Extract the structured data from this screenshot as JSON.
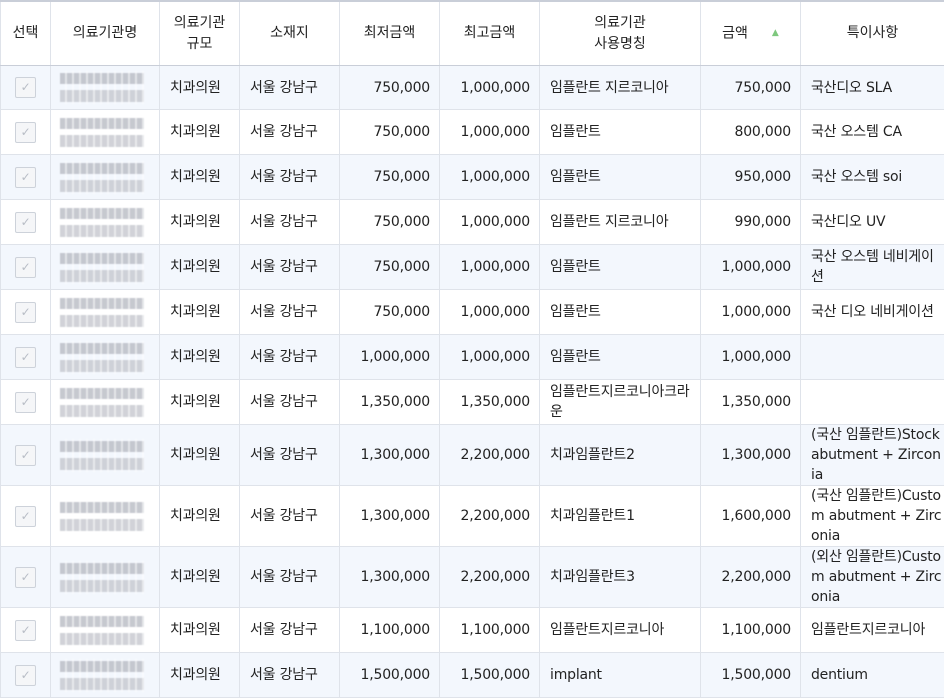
{
  "table": {
    "headers": {
      "select": "선택",
      "institution_name": "의료기관명",
      "institution_size": "의료기관\n규모",
      "location": "소재지",
      "min_amount": "최저금액",
      "max_amount": "최고금액",
      "usage_name": "의료기관\n사용명칭",
      "amount": "금액",
      "remarks": "특이사항"
    },
    "sort_icon": "sort-ascending-icon",
    "rows": [
      {
        "size": "치과의원",
        "location": "서울 강남구",
        "min": "750,000",
        "max": "1,000,000",
        "usage": "임플란트 지르코니아",
        "amount": "750,000",
        "note": "국산디오 SLA"
      },
      {
        "size": "치과의원",
        "location": "서울 강남구",
        "min": "750,000",
        "max": "1,000,000",
        "usage": "임플란트",
        "amount": "800,000",
        "note": "국산 오스템 CA"
      },
      {
        "size": "치과의원",
        "location": "서울 강남구",
        "min": "750,000",
        "max": "1,000,000",
        "usage": "임플란트",
        "amount": "950,000",
        "note": "국산 오스템 soi"
      },
      {
        "size": "치과의원",
        "location": "서울 강남구",
        "min": "750,000",
        "max": "1,000,000",
        "usage": "임플란트 지르코니아",
        "amount": "990,000",
        "note": "국산디오 UV"
      },
      {
        "size": "치과의원",
        "location": "서울 강남구",
        "min": "750,000",
        "max": "1,000,000",
        "usage": "임플란트",
        "amount": "1,000,000",
        "note": "국산 오스템 네비게이션"
      },
      {
        "size": "치과의원",
        "location": "서울 강남구",
        "min": "750,000",
        "max": "1,000,000",
        "usage": "임플란트",
        "amount": "1,000,000",
        "note": "국산 디오 네비게이션"
      },
      {
        "size": "치과의원",
        "location": "서울 강남구",
        "min": "1,000,000",
        "max": "1,000,000",
        "usage": "임플란트",
        "amount": "1,000,000",
        "note": ""
      },
      {
        "size": "치과의원",
        "location": "서울 강남구",
        "min": "1,350,000",
        "max": "1,350,000",
        "usage": "임플란트지르코니아크라운",
        "amount": "1,350,000",
        "note": ""
      },
      {
        "size": "치과의원",
        "location": "서울 강남구",
        "min": "1,300,000",
        "max": "2,200,000",
        "usage": "치과임플란트2",
        "amount": "1,300,000",
        "note": "(국산 임플란트)Stock abutment + Zirconia"
      },
      {
        "size": "치과의원",
        "location": "서울 강남구",
        "min": "1,300,000",
        "max": "2,200,000",
        "usage": "치과임플란트1",
        "amount": "1,600,000",
        "note": "(국산 임플란트)Custom abutment + Zirconia"
      },
      {
        "size": "치과의원",
        "location": "서울 강남구",
        "min": "1,300,000",
        "max": "2,200,000",
        "usage": "치과임플란트3",
        "amount": "2,200,000",
        "note": "(외산 임플란트)Custom abutment + Zirconia"
      },
      {
        "size": "치과의원",
        "location": "서울 강남구",
        "min": "1,100,000",
        "max": "1,100,000",
        "usage": "임플란트지르코니아",
        "amount": "1,100,000",
        "note": "임플란트지르코니아"
      },
      {
        "size": "치과의원",
        "location": "서울 강남구",
        "min": "1,500,000",
        "max": "1,500,000",
        "usage": "implant",
        "amount": "1,500,000",
        "note": "dentium"
      }
    ]
  }
}
